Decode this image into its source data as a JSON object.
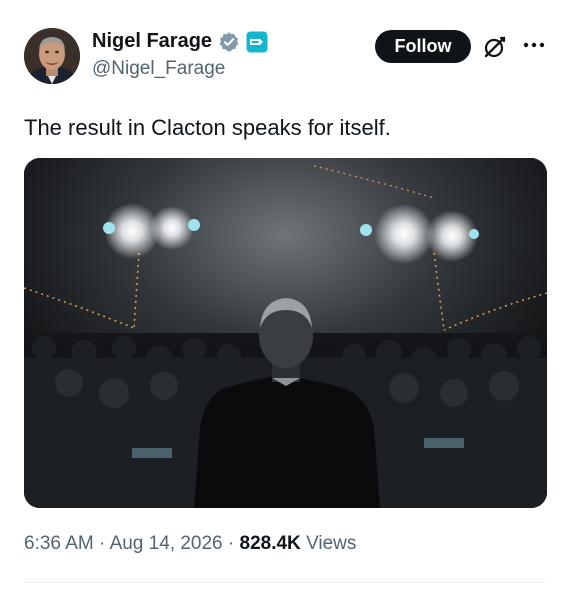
{
  "author": {
    "display_name": "Nigel Farage",
    "handle": "@Nigel_Farage",
    "verified_icon": "verified-badge-icon",
    "affiliate_icon": "reform-uk-affiliate-icon"
  },
  "actions": {
    "follow_label": "Follow",
    "grok_icon": "grok-icon",
    "more_icon": "more-options-icon"
  },
  "tweet": {
    "text": "The result in Clacton speaks for itself.",
    "media_icon": "photo-of-man-addressing-crowd"
  },
  "meta": {
    "time": "6:36 AM",
    "separator": "·",
    "date": "Aug 14, 2026",
    "views_count": "828.4K",
    "views_label": "Views"
  },
  "colors": {
    "text_primary": "#0f1419",
    "text_secondary": "#536471",
    "verified": "#829aab",
    "follow_bg": "#0f1419"
  }
}
